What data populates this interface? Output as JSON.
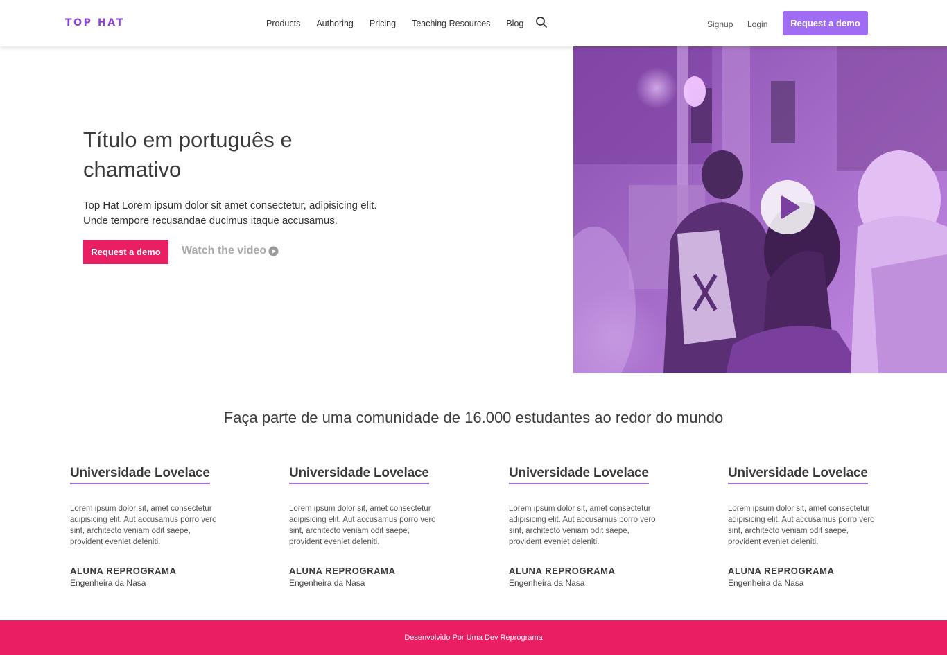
{
  "brand": {
    "logo": "TOP HAT",
    "accent": "#9f6cf2",
    "logo_color": "#8c3fd9",
    "pink": "#e91e63"
  },
  "nav": {
    "links": [
      "Products",
      "Authoring",
      "Pricing",
      "Teaching Resources",
      "Blog"
    ],
    "search_icon": "search-icon",
    "signup": "Signup",
    "login": "Login",
    "demo_button": "Request a demo"
  },
  "hero": {
    "title": "Título em português e chamativo",
    "text": "Top Hat Lorem ipsum dolor sit amet consectetur, adipisicing elit. Unde tempore recusandae ducimus itaque accusamus.",
    "demo_button": "Request a demo",
    "watch_label": "Watch the video",
    "watch_icon": "play-circle-icon",
    "video_icon": "play-icon"
  },
  "community": {
    "title": "Faça parte de uma comunidade de 16.000 estudantes ao redor do mundo",
    "cards": [
      {
        "title": "Universidade Lovelace",
        "text": "Lorem ipsum dolor sit, amet consectetur adipisicing elit. Aut accusamus porro vero sint, architecto veniam odit saepe, provident eveniet deleniti.",
        "author": "ALUNA REPROGRAMA",
        "role": "Engenheira da Nasa"
      },
      {
        "title": "Universidade Lovelace",
        "text": "Lorem ipsum dolor sit, amet consectetur adipisicing elit. Aut accusamus porro vero sint, architecto veniam odit saepe, provident eveniet deleniti.",
        "author": "ALUNA REPROGRAMA",
        "role": "Engenheira da Nasa"
      },
      {
        "title": "Universidade Lovelace",
        "text": "Lorem ipsum dolor sit, amet consectetur adipisicing elit. Aut accusamus porro vero sint, architecto veniam odit saepe, provident eveniet deleniti.",
        "author": "ALUNA REPROGRAMA",
        "role": "Engenheira da Nasa"
      },
      {
        "title": "Universidade Lovelace",
        "text": "Lorem ipsum dolor sit, amet consectetur adipisicing elit. Aut accusamus porro vero sint, architecto veniam odit saepe, provident eveniet deleniti.",
        "author": "ALUNA REPROGRAMA",
        "role": "Engenheira da Nasa"
      }
    ]
  },
  "footer": {
    "text": "Desenvolvido Por Uma Dev Reprograma"
  }
}
